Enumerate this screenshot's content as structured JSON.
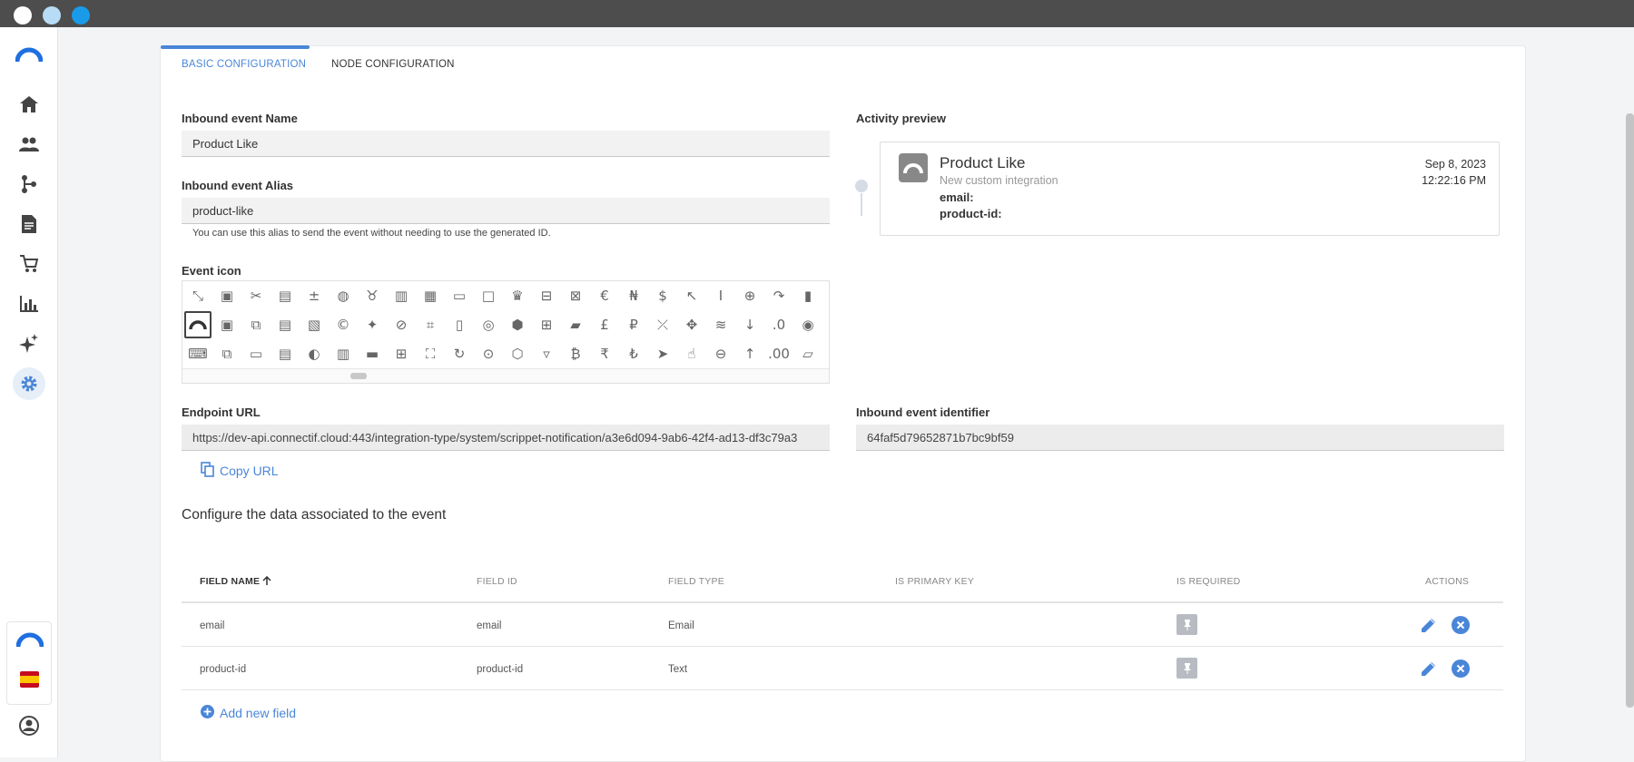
{
  "window": {
    "dot_colors": [
      "#ffffff",
      "#b8dcf5",
      "#1a9bea"
    ]
  },
  "sidebar": {
    "items": [
      {
        "icon": "connectif-logo-icon"
      },
      {
        "icon": "home-icon"
      },
      {
        "icon": "people-icon"
      },
      {
        "icon": "workflow-icon"
      },
      {
        "icon": "document-icon"
      },
      {
        "icon": "cart-icon"
      },
      {
        "icon": "bar-chart-icon"
      },
      {
        "icon": "sparkle-icon"
      },
      {
        "icon": "settings-icon",
        "active": true
      }
    ],
    "bottom": [
      {
        "icon": "connectif-logo-icon"
      },
      {
        "icon": "spain-flag-icon"
      },
      {
        "icon": "account-icon"
      }
    ]
  },
  "tabs": [
    {
      "label": "BASIC CONFIGURATION",
      "active": true
    },
    {
      "label": "NODE CONFIGURATION",
      "active": false
    }
  ],
  "form": {
    "name_label": "Inbound event Name",
    "name_value": "Product Like",
    "alias_label": "Inbound event Alias",
    "alias_value": "product-like",
    "alias_hint": "You can use this alias to send the event without needing to use the generated ID.",
    "icon_label": "Event icon",
    "endpoint_label": "Endpoint URL",
    "endpoint_value": "https://dev-api.connectif.cloud:443/integration-type/system/scrippet-notification/a3e6d094-9ab6-42f4-ad13-df3c79a3",
    "copy_url_label": "Copy URL",
    "identifier_label": "Inbound event identifier",
    "identifier_value": "64faf5d79652871b7bc9bf59"
  },
  "preview": {
    "label": "Activity preview",
    "title": "Product Like",
    "subtitle": "New custom integration",
    "fields": [
      "email:",
      "product-id:"
    ],
    "date": "Sep 8, 2023",
    "time": "12:22:16 PM"
  },
  "data_section": {
    "title": "Configure the data associated to the event",
    "headers": {
      "field_name": "FIELD NAME",
      "field_id": "FIELD ID",
      "field_type": "FIELD TYPE",
      "is_primary_key": "IS PRIMARY KEY",
      "is_required": "IS REQUIRED",
      "actions": "ACTIONS"
    },
    "sort_icon": "arrow-up-icon",
    "rows": [
      {
        "name": "email",
        "id": "email",
        "type": "Email"
      },
      {
        "name": "product-id",
        "id": "product-id",
        "type": "Text"
      }
    ],
    "add_label": "Add new field"
  },
  "colors": {
    "accent": "#4a86d8",
    "titlebar": "#4d4d4d"
  }
}
